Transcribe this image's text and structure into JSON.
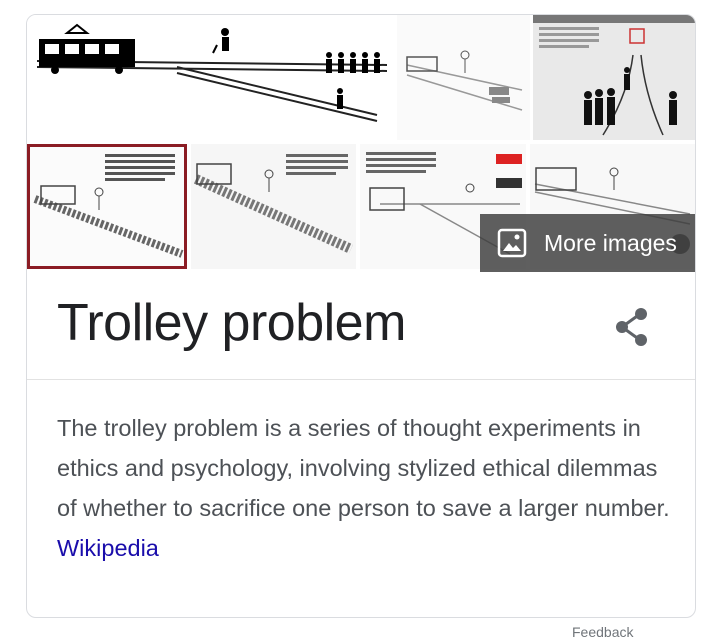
{
  "gallery": {
    "more_images_label": "More images",
    "tiles": [
      {
        "icon": "trolley-diagram"
      },
      {
        "icon": "trolley-sketch"
      },
      {
        "icon": "trolley-crowd-illustration"
      },
      {
        "icon": "trolley-sketch-selected"
      },
      {
        "icon": "trolley-sketch"
      },
      {
        "icon": "trolley-sketch"
      },
      {
        "icon": "trolley-sketch"
      }
    ]
  },
  "panel": {
    "title": "Trolley problem",
    "description": "The trolley problem is a series of thought experiments in ethics and psychology, involving stylized ethical dilemmas of whether to sacrifice one person to save a larger number. ",
    "source_link": "Wikipedia",
    "share_icon": "share-icon"
  },
  "footer": {
    "feedback_label": "Feedback"
  },
  "colors": {
    "title": "#202124",
    "body_text": "#4d5156",
    "link": "#1a0dab",
    "selected_border": "#8b1c24",
    "overlay": "#3c3c3c"
  }
}
